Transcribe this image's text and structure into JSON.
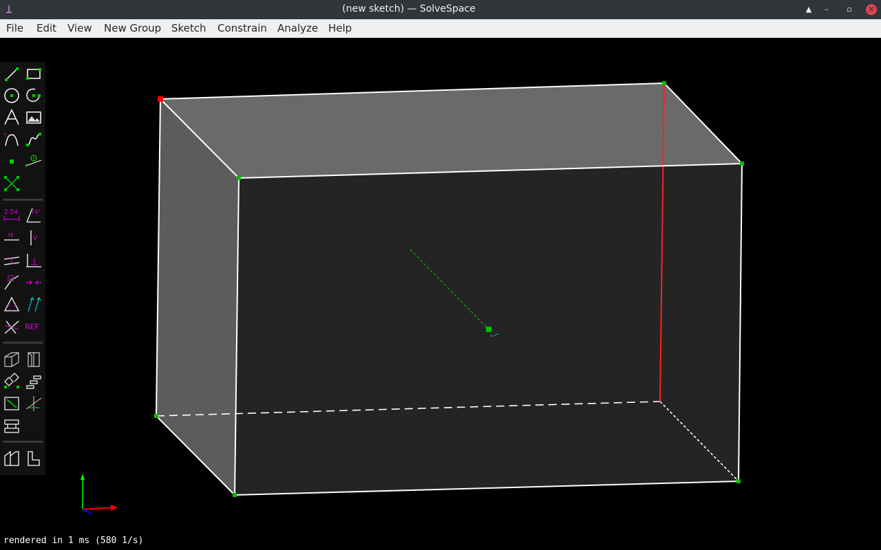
{
  "window": {
    "title": "(new sketch) — SolveSpace",
    "icons": [
      "app-icon",
      "keep-above-icon",
      "minimize-icon",
      "maximize-icon",
      "close-icon"
    ]
  },
  "menubar": {
    "items": [
      "File",
      "Edit",
      "View",
      "New Group",
      "Sketch",
      "Constrain",
      "Analyze",
      "Help"
    ]
  },
  "toolbar": {
    "sketch_tools": [
      "line-segment-icon",
      "rectangle-icon",
      "circle-icon",
      "arc-icon",
      "text-icon",
      "image-icon",
      "tangent-arc-icon",
      "cubic-spline-icon",
      "datum-point-icon",
      "workplane-icon",
      "construction-toggle-icon"
    ],
    "constraint_tools": [
      "distance-dimension-icon",
      "angle-dimension-icon",
      "horizontal-icon",
      "vertical-icon",
      "parallel-icon",
      "perpendicular-icon",
      "point-on-entity-icon",
      "symmetric-icon",
      "equal-length-icon",
      "same-orientation-icon",
      "other-supplementary-icon",
      "reference-icon"
    ],
    "group_tools": [
      "extrude-icon",
      "lathe-icon",
      "step-rotate-icon",
      "step-translate-icon",
      "sketch-in-new-workplane-icon",
      "sketch-in-3d-icon",
      "link-part-icon",
      "assemble-icon",
      "sketch-2d-icon"
    ],
    "labels": {
      "distance": "2.54",
      "angle": "74°",
      "horizontal": "H",
      "vertical": "V",
      "reference": "REF"
    }
  },
  "viewport": {
    "axis_colors": {
      "x": "#ff0000",
      "y": "#00ff00",
      "z": "#0000ff"
    },
    "colors": {
      "edge": "#ffffff",
      "selected_edge": "#ff2020",
      "point": "#00c000",
      "selected_point": "#ff0000",
      "construction": "#00aa00",
      "face_light": "#6a6a6a",
      "face_dark": "#242424"
    }
  },
  "status": {
    "text": "rendered in 1 ms (580 1/s)"
  }
}
